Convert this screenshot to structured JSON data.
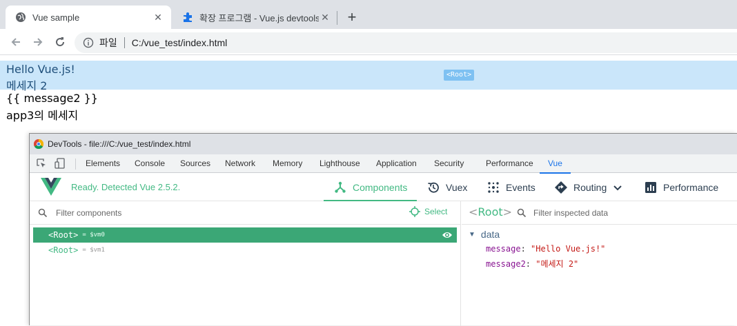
{
  "browser": {
    "tabs": [
      {
        "label": "Vue sample",
        "icon": "globe-icon",
        "active": true
      },
      {
        "label": "확장 프로그램 - Vue.js devtools",
        "icon": "puzzle-icon",
        "active": false
      }
    ],
    "address": {
      "scheme": "파일",
      "url": "C:/vue_test/index.html"
    }
  },
  "page": {
    "root_badge": "<Root>",
    "lines": [
      "Hello Vue.js!",
      "메세지 2",
      "{{ message2 }}",
      "app3의 메세지"
    ]
  },
  "devtools": {
    "title": "DevTools - file:///C:/vue_test/index.html",
    "tabs": [
      "Elements",
      "Console",
      "Sources",
      "Network",
      "Memory",
      "Lighthouse",
      "Application",
      "Security",
      "Performance",
      "Vue"
    ],
    "selected_tab": "Vue",
    "vue": {
      "status": "Ready. Detected Vue 2.5.2.",
      "nav": [
        {
          "label": "Components",
          "icon": "components-icon"
        },
        {
          "label": "Vuex",
          "icon": "history-icon"
        },
        {
          "label": "Events",
          "icon": "events-icon"
        },
        {
          "label": "Routing",
          "icon": "routing-icon"
        },
        {
          "label": "Performance",
          "icon": "bar-chart-icon"
        }
      ],
      "filter_components_placeholder": "Filter components",
      "select_label": "Select",
      "components": [
        {
          "name": "<Root>",
          "vm": "= $vm0",
          "selected": true
        },
        {
          "name": "<Root>",
          "vm": "= $vm1",
          "selected": false
        }
      ],
      "inspected": {
        "name": "Root",
        "filter_placeholder": "Filter inspected data",
        "section": "data",
        "props": [
          {
            "key": "message",
            "value": "\"Hello Vue.js!\""
          },
          {
            "key": "message2",
            "value": "\"메세지 2\""
          }
        ]
      }
    }
  },
  "colors": {
    "vue_green": "#42b983",
    "selected_row": "#3ba776",
    "highlight": "#b8d9f6",
    "devtools_blue": "#1a73e8"
  }
}
